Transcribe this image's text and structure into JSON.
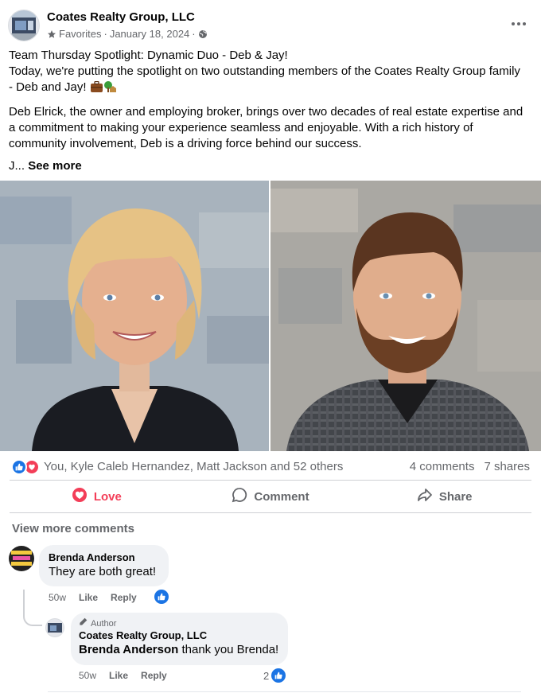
{
  "post": {
    "page_name": "Coates Realty Group, LLC",
    "favorites_label": "Favorites",
    "date": "January 18, 2024",
    "separator": "·",
    "paragraphs": [
      "Team Thursday Spotlight: Dynamic Duo - Deb & Jay!",
      "Today, we're putting the spotlight on two outstanding members of the Coates Realty Group family - Deb and Jay!",
      "Deb Elrick, the owner and employing broker, brings over two decades of real estate expertise and a commitment to making your experience seamless and enjoyable. With a rich history of community involvement, Deb is a driving force behind our success."
    ],
    "truncated_prefix": "J...",
    "see_more": "See more"
  },
  "reactions": {
    "names": "You, Kyle Caleb Hernandez, Matt Jackson and 52 others",
    "comments": "4 comments",
    "shares": "7 shares",
    "like_color": "#1b74e4",
    "love_color": "#f33e58"
  },
  "actions": {
    "love": "Love",
    "comment": "Comment",
    "share": "Share"
  },
  "comments": {
    "view_more": "View more comments",
    "items": [
      {
        "name": "Brenda Anderson",
        "text": "They are both great!",
        "time": "50w",
        "like": "Like",
        "reply": "Reply"
      }
    ],
    "reply": {
      "badge": "Author",
      "name": "Coates Realty Group, LLC",
      "mention": "Brenda Anderson",
      "text": " thank you Brenda!",
      "time": "50w",
      "like": "Like",
      "reply": "Reply",
      "like_count": "2"
    }
  },
  "icons": {
    "favorites": "star-icon",
    "audience": "globe-icon",
    "more": "more-options-icon",
    "like": "like-icon",
    "love": "heart-icon",
    "comment": "comment-icon",
    "share": "share-icon",
    "author": "pencil-icon"
  }
}
